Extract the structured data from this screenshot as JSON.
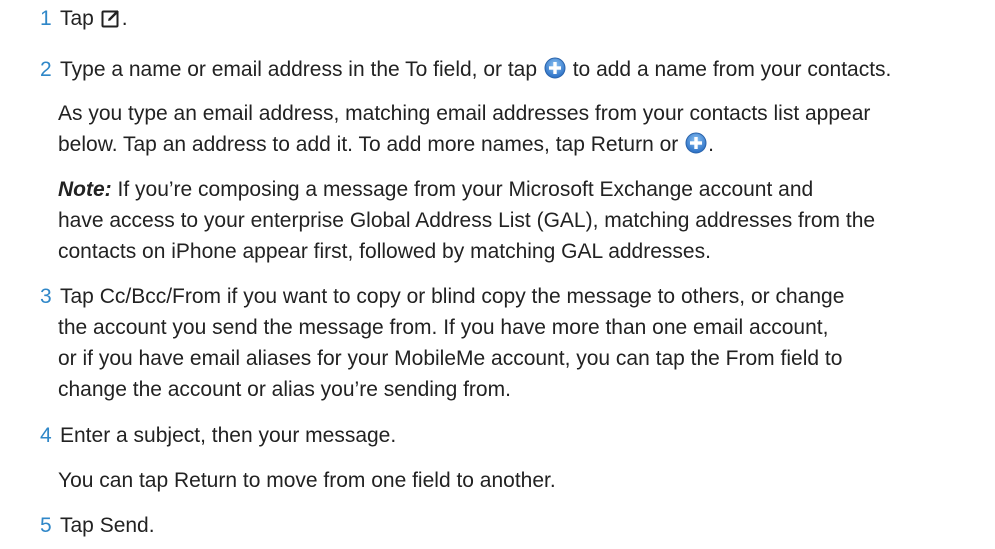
{
  "steps": [
    {
      "number": "1",
      "text_before": "Tap ",
      "icon": "compose-icon",
      "text_after": "."
    },
    {
      "number": "2",
      "text_before": "Type a name or email address in the To field, or tap ",
      "icon": "add-contact-icon",
      "text_after": " to add a name from your contacts.",
      "detail": {
        "line1": "As you type an email address, matching email addresses from your contacts list appear",
        "line2_before": "below. Tap an address to add it. To add more names, tap Return or ",
        "line2_icon": "add-contact-icon",
        "line2_after": "."
      },
      "note": {
        "label": "Note:",
        "line1": " If you’re composing a message from your Microsoft Exchange account and",
        "line2": "have access to your enterprise Global Address List (GAL), matching addresses from the",
        "line3": "contacts on iPhone appear first, followed by matching GAL addresses."
      }
    },
    {
      "number": "3",
      "lines": [
        "Tap Cc/Bcc/From if you want to copy or blind copy the message to others, or change",
        "the account you send the message from. If you have more than one email account,",
        "or if you have email aliases for your MobileMe account, you can tap the From field to",
        "change the account or alias you’re sending from."
      ]
    },
    {
      "number": "4",
      "text": "Enter a subject, then your message.",
      "detail": "You can tap Return to move from one field to another."
    },
    {
      "number": "5",
      "text": "Tap Send."
    }
  ],
  "colors": {
    "step_number": "#2f87c8",
    "text": "#222222",
    "add_icon": "#4a8ed8"
  }
}
